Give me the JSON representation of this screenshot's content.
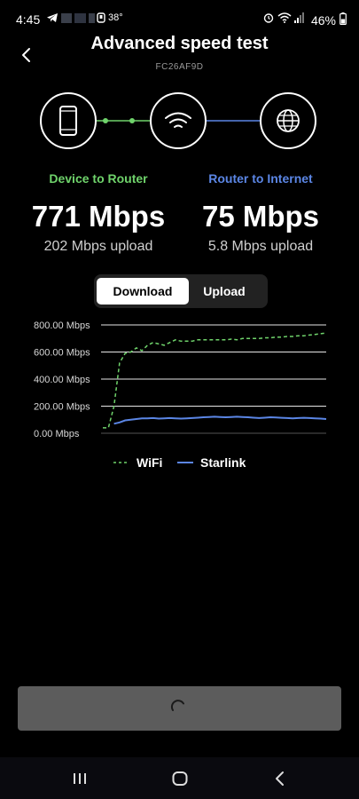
{
  "status_bar": {
    "time": "4:45",
    "temperature": "38°",
    "battery": "46%"
  },
  "header": {
    "title": "Advanced speed test",
    "device_id": "FC26AF9D"
  },
  "topology": {
    "nodes": [
      "phone-icon",
      "router-wifi-icon",
      "globe-icon"
    ],
    "device_link_color": "#6fd36b",
    "internet_link_color": "#5b86e5"
  },
  "device_to_router": {
    "label": "Device to Router",
    "download": "771 Mbps",
    "upload": "202 Mbps upload"
  },
  "router_to_internet": {
    "label": "Router to Internet",
    "download": "75 Mbps",
    "upload": "5.8 Mbps upload"
  },
  "toggle": {
    "download_label": "Download",
    "upload_label": "Upload",
    "selected": "Download"
  },
  "chart_data": {
    "type": "line",
    "title": "",
    "xlabel": "",
    "ylabel": "",
    "ylim": [
      0,
      800
    ],
    "y_ticks": [
      "0.00 Mbps",
      "200.00 Mbps",
      "400.00 Mbps",
      "600.00 Mbps",
      "800.00 Mbps"
    ],
    "y_tick_values": [
      0,
      200,
      400,
      600,
      800
    ],
    "grid": true,
    "legend_position": "bottom",
    "x": [
      0,
      1,
      2,
      3,
      4,
      5,
      6,
      7,
      8,
      9,
      10,
      11,
      12,
      13,
      14,
      15,
      16,
      17,
      18,
      19,
      20,
      21,
      22,
      23,
      24,
      25,
      26,
      27,
      28,
      29,
      30,
      31,
      32,
      33,
      34,
      35,
      36,
      37,
      38,
      39,
      40
    ],
    "series": [
      {
        "name": "WiFi",
        "style": "dashed",
        "color": "#6fd36b",
        "values": [
          40,
          40,
          200,
          520,
          590,
          600,
          630,
          610,
          650,
          670,
          660,
          650,
          670,
          690,
          680,
          680,
          680,
          690,
          690,
          690,
          690,
          690,
          690,
          695,
          690,
          700,
          700,
          700,
          700,
          705,
          705,
          710,
          710,
          715,
          715,
          720,
          720,
          725,
          730,
          735,
          740
        ]
      },
      {
        "name": "Starlink",
        "style": "solid",
        "color": "#5b86e5",
        "values": [
          null,
          null,
          70,
          80,
          95,
          100,
          105,
          110,
          110,
          112,
          108,
          110,
          112,
          110,
          108,
          110,
          112,
          115,
          118,
          120,
          122,
          120,
          118,
          120,
          122,
          120,
          118,
          115,
          112,
          115,
          118,
          116,
          114,
          112,
          110,
          112,
          114,
          112,
          110,
          108,
          105
        ]
      }
    ]
  },
  "legend": {
    "wifi": "WiFi",
    "starlink": "Starlink"
  },
  "nav": {
    "recents": "recents-icon",
    "home": "home-icon",
    "back": "back-icon"
  }
}
